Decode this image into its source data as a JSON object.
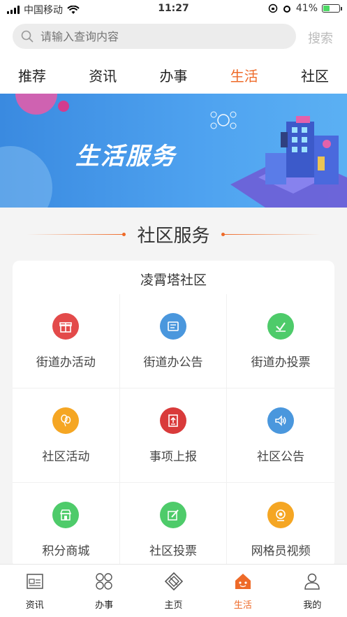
{
  "status": {
    "carrier": "中国移动",
    "time": "11:27",
    "battery": "41%",
    "battery_level": 0.41
  },
  "search": {
    "placeholder": "请输入查询内容",
    "button": "搜索"
  },
  "tabs": [
    {
      "label": "推荐"
    },
    {
      "label": "资讯"
    },
    {
      "label": "办事"
    },
    {
      "label": "生活",
      "active": true
    },
    {
      "label": "社区"
    }
  ],
  "banner": {
    "title": "生活服务"
  },
  "section": {
    "title": "社区服务"
  },
  "card": {
    "title": "凌霄塔社区",
    "items": [
      {
        "label": "街道办活动",
        "icon": "gift-icon",
        "color": "#e34a4a"
      },
      {
        "label": "街道办公告",
        "icon": "notice-icon",
        "color": "#4a97dd"
      },
      {
        "label": "街道办投票",
        "icon": "vote-icon",
        "color": "#4ecb6a"
      },
      {
        "label": "社区活动",
        "icon": "balloon-icon",
        "color": "#f5a623"
      },
      {
        "label": "事项上报",
        "icon": "report-upload-icon",
        "color": "#d93b3b"
      },
      {
        "label": "社区公告",
        "icon": "speaker-icon",
        "color": "#4a97dd"
      },
      {
        "label": "积分商城",
        "icon": "shop-icon",
        "color": "#4ecb6a"
      },
      {
        "label": "社区投票",
        "icon": "pen-vote-icon",
        "color": "#4ecb6a"
      },
      {
        "label": "网格员视频",
        "icon": "camera-icon",
        "color": "#f5a623"
      }
    ]
  },
  "bottom_nav": [
    {
      "label": "资讯",
      "icon": "news-icon"
    },
    {
      "label": "办事",
      "icon": "grid-circles-icon"
    },
    {
      "label": "主页",
      "icon": "home-logo-icon"
    },
    {
      "label": "生活",
      "icon": "life-house-icon",
      "active": true
    },
    {
      "label": "我的",
      "icon": "user-icon"
    }
  ],
  "colors": {
    "accent": "#ee6a28",
    "banner": "#4a9ae8"
  }
}
